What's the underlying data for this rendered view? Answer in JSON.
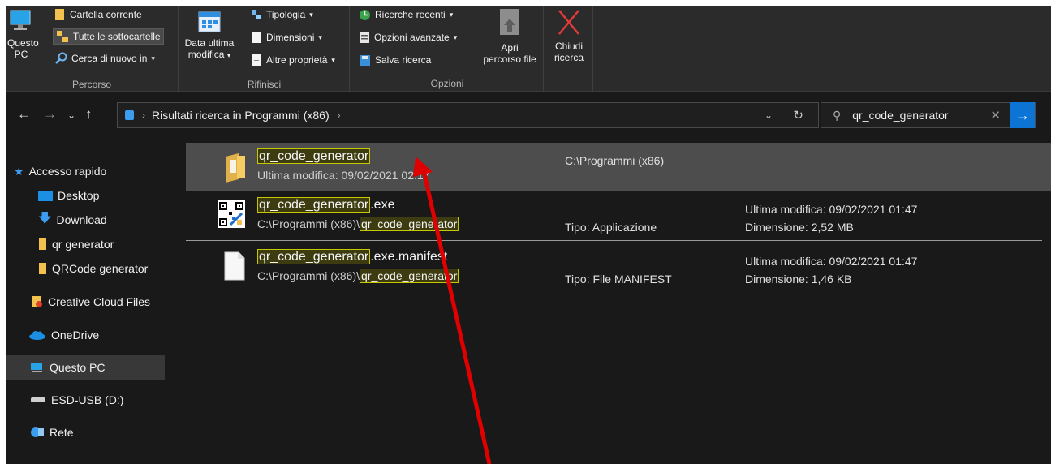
{
  "ribbon": {
    "percorso": {
      "label": "Percorso",
      "questo_pc_line1": "Questo",
      "questo_pc_line2": "PC",
      "cartella_corrente": "Cartella corrente",
      "tutte_sottocartelle": "Tutte le sottocartelle",
      "cerca_di_nuovo": "Cerca di nuovo in"
    },
    "rifinisci": {
      "label": "Rifinisci",
      "data_line1": "Data ultima",
      "data_line2": "modifica",
      "tipologia": "Tipologia",
      "dimensioni": "Dimensioni",
      "altre_proprieta": "Altre proprietà"
    },
    "opzioni": {
      "label": "Opzioni",
      "ricerche_recenti": "Ricerche recenti",
      "opzioni_avanzate": "Opzioni avanzate",
      "salva_ricerca": "Salva ricerca",
      "apri_line1": "Apri",
      "apri_line2": "percorso file",
      "chiudi_line1": "Chiudi",
      "chiudi_line2": "ricerca"
    }
  },
  "address": {
    "path": "Risultati ricerca in Programmi (x86)",
    "search_value": "qr_code_generator"
  },
  "sidebar": {
    "items": [
      {
        "label": "Accesso rapido"
      },
      {
        "label": "Desktop"
      },
      {
        "label": "Download"
      },
      {
        "label": "qr generator"
      },
      {
        "label": "QRCode generator"
      },
      {
        "label": "Creative Cloud Files"
      },
      {
        "label": "OneDrive"
      },
      {
        "label": "Questo PC"
      },
      {
        "label": "ESD-USB (D:)"
      },
      {
        "label": "Rete"
      }
    ]
  },
  "results": [
    {
      "name_match": "qr_code_generator",
      "name_rest": "",
      "sub_text": "Ultima modifica: 09/02/2021 02:17",
      "location": "C:\\Programmi (x86)"
    },
    {
      "name_match": "qr_code_generator",
      "name_rest": ".exe",
      "sub_prefix": "C:\\Programmi (x86)\\",
      "sub_match": "qr_code_generator",
      "type": "Tipo: Applicazione",
      "modified": "Ultima modifica: 09/02/2021 01:47",
      "size": "Dimensione: 2,52 MB"
    },
    {
      "name_match": "qr_code_generator",
      "name_rest": ".exe.manifest",
      "sub_prefix": "C:\\Programmi (x86)\\",
      "sub_match": "qr_code_generator",
      "type": "Tipo: File MANIFEST",
      "modified": "Ultima modifica: 09/02/2021 01:47",
      "size": "Dimensione: 1,46 KB"
    }
  ],
  "colors": {
    "background": "#191919",
    "highlight_border": "#c8c800",
    "accent": "#0b74d4",
    "arrow": "#e00000"
  }
}
